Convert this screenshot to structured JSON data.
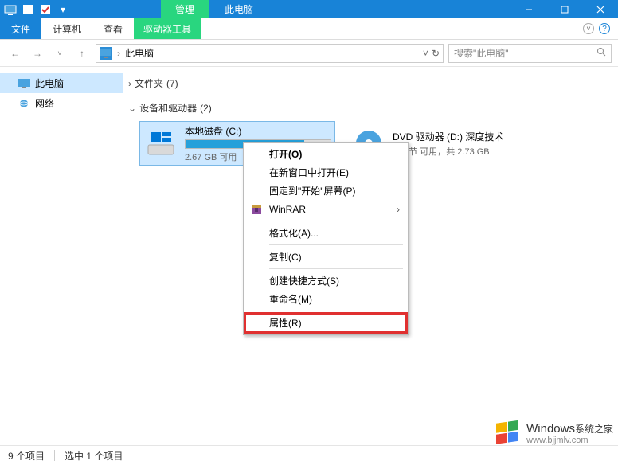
{
  "titlebar": {
    "ribbon_tab": "管理",
    "title": "此电脑"
  },
  "menubar": {
    "file": "文件",
    "computer": "计算机",
    "view": "查看",
    "drive_tools": "驱动器工具"
  },
  "nav": {
    "location": "此电脑",
    "search_placeholder": "搜索\"此电脑\""
  },
  "sidebar": {
    "items": [
      {
        "label": "此电脑",
        "selected": true
      },
      {
        "label": "网络",
        "selected": false
      }
    ]
  },
  "content": {
    "folders": {
      "label": "文件夹",
      "count": "(7)"
    },
    "devices": {
      "label": "设备和驱动器",
      "count": "(2)"
    },
    "drives": [
      {
        "name": "本地磁盘 (C:)",
        "free_text": "2.67 GB 可用",
        "fill_pct": 82,
        "selected": true,
        "type": "hdd"
      },
      {
        "name": "DVD 驱动器 (D:) 深度技术",
        "free_text": "0 字节 可用，共 2.73 GB",
        "fill_pct": 0,
        "selected": false,
        "type": "dvd"
      }
    ]
  },
  "context_menu": {
    "items": [
      {
        "label": "打开(O)",
        "bold": true
      },
      {
        "label": "在新窗口中打开(E)"
      },
      {
        "label": "固定到\"开始\"屏幕(P)"
      },
      {
        "label": "WinRAR",
        "icon": "winrar",
        "submenu": true
      },
      {
        "sep": true
      },
      {
        "label": "格式化(A)..."
      },
      {
        "sep": true
      },
      {
        "label": "复制(C)"
      },
      {
        "sep": true
      },
      {
        "label": "创建快捷方式(S)"
      },
      {
        "label": "重命名(M)"
      },
      {
        "sep": true
      },
      {
        "label": "属性(R)",
        "highlight": true
      }
    ]
  },
  "statusbar": {
    "count": "9 个项目",
    "selected": "选中 1 个项目"
  },
  "watermark": {
    "win": "Windows",
    "zh": "系统之家",
    "url": "www.bjjmlv.com"
  }
}
